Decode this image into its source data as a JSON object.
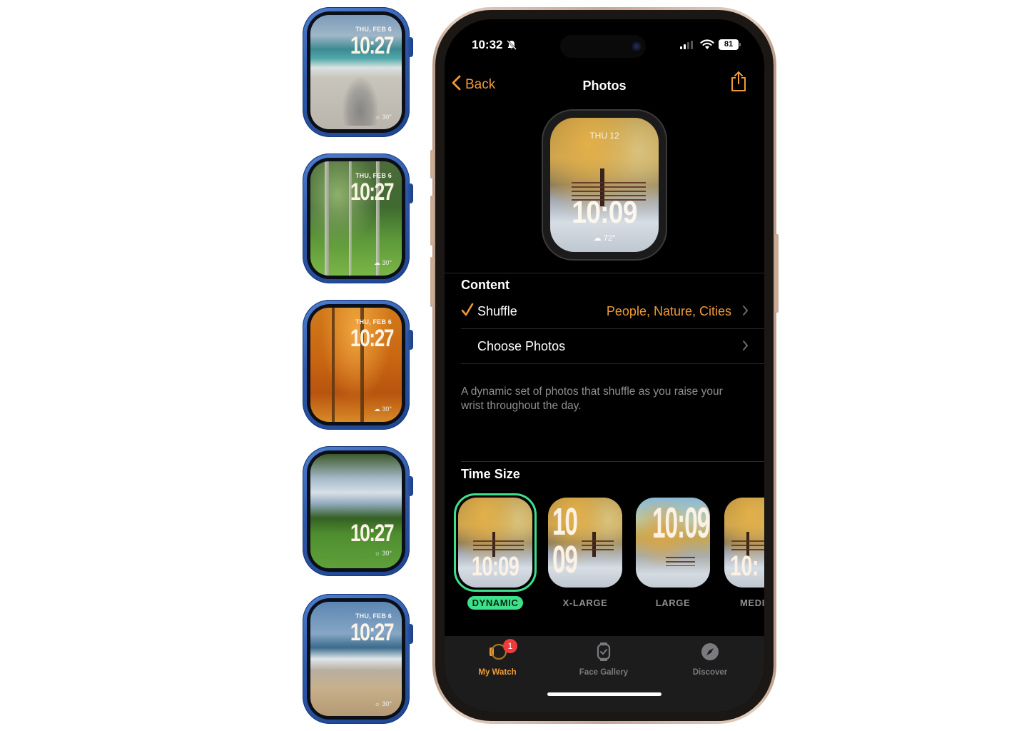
{
  "watches": [
    {
      "date": "THU, FEB 6",
      "time": "10:27",
      "temp": "30°",
      "scene": "beach with shadows"
    },
    {
      "date": "THU, FEB 6",
      "time": "10:27",
      "temp": "30°",
      "scene": "green forest swamp"
    },
    {
      "date": "THU, FEB 6",
      "time": "10:27",
      "temp": "30°",
      "scene": "autumn forest"
    },
    {
      "date": "",
      "time": "10:27",
      "temp": "30°",
      "scene": "lakeside park lawn"
    },
    {
      "date": "THU, FEB 6",
      "time": "10:27",
      "temp": "30°",
      "scene": "beach shoreline"
    }
  ],
  "status_bar": {
    "time": "10:32",
    "silent_icon": "bell-slash-icon",
    "battery": "81"
  },
  "nav": {
    "back_label": "Back",
    "title": "Photos",
    "share_icon": "share-icon"
  },
  "preview": {
    "date": "THU 12",
    "time": "10:09",
    "temp": "72°"
  },
  "content": {
    "section_title": "Content",
    "rows": [
      {
        "label": "Shuffle",
        "value": "People, Nature, Cities",
        "checked": true
      },
      {
        "label": "Choose Photos",
        "value": "",
        "checked": false
      }
    ],
    "footnote": "A dynamic set of photos that shuffle as you raise your wrist throughout the day."
  },
  "time_size": {
    "section_title": "Time Size",
    "selected": "DYNAMIC",
    "options": [
      {
        "label": "DYNAMIC",
        "time": "10:09"
      },
      {
        "label": "X-LARGE",
        "time": "10 09"
      },
      {
        "label": "LARGE",
        "time": "10:09"
      },
      {
        "label": "MEDI",
        "time": "10:"
      }
    ]
  },
  "tabbar": {
    "items": [
      {
        "label": "My Watch",
        "icon": "my-watch-icon",
        "badge": "1",
        "active": true
      },
      {
        "label": "Face Gallery",
        "icon": "watch-face-icon",
        "active": false
      },
      {
        "label": "Discover",
        "icon": "compass-icon",
        "active": false
      }
    ]
  },
  "colors": {
    "accent": "#f09a37",
    "selected_green": "#3ee08a",
    "badge_red": "#ef3b3b",
    "watch_case_blue": "#2d58a8"
  }
}
